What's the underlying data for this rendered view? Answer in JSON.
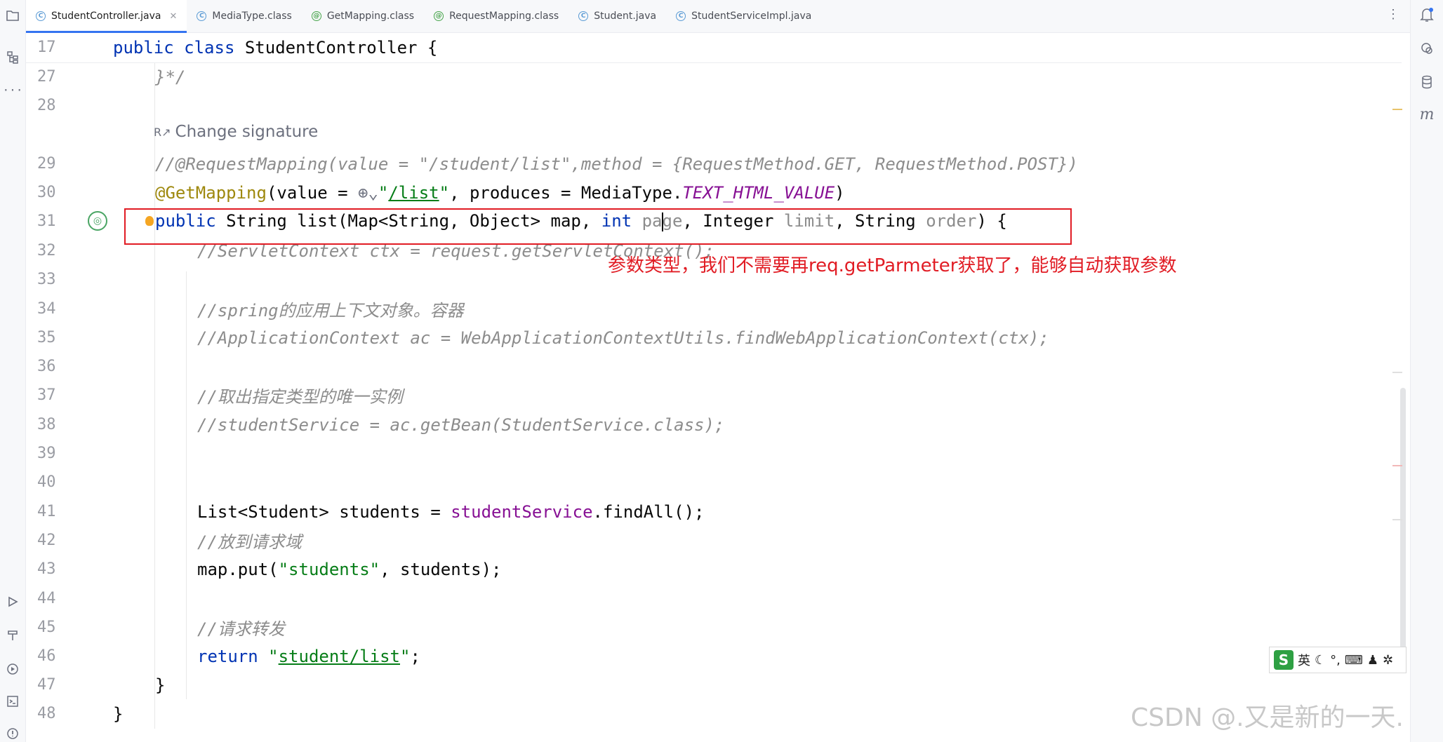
{
  "tabs": [
    {
      "label": "StudentController.java",
      "icon": "class-icon",
      "active": true,
      "closable": true
    },
    {
      "label": "MediaType.class",
      "icon": "class-icon",
      "active": false
    },
    {
      "label": "GetMapping.class",
      "icon": "annotation-icon",
      "active": false
    },
    {
      "label": "RequestMapping.class",
      "icon": "annotation-icon",
      "active": false
    },
    {
      "label": "Student.java",
      "icon": "class-icon",
      "active": false
    },
    {
      "label": "StudentServiceImpl.java",
      "icon": "class-icon",
      "active": false
    }
  ],
  "inspections": {
    "warnings": "4",
    "weak_warnings": "2"
  },
  "sticky": {
    "line": "17",
    "code": "public class StudentController {"
  },
  "inlay_hint": {
    "label": "Change signature"
  },
  "lines": [
    {
      "num": "27",
      "text": "}*/"
    },
    {
      "num": "28",
      "text": ""
    },
    {
      "num": "29",
      "text": "//@RequestMapping(value = \"/student/list\",method = {RequestMethod.GET, RequestMethod.POST})"
    },
    {
      "num": "30",
      "text": "@GetMapping(value = \"/list\", produces = MediaType.TEXT_HTML_VALUE)"
    },
    {
      "num": "31",
      "text": "public String list(Map<String, Object> map, int page, Integer limit, String order) {"
    },
    {
      "num": "32",
      "text": "//ServletContext ctx = request.getServletContext();"
    },
    {
      "num": "33",
      "text": ""
    },
    {
      "num": "34",
      "text": "//spring的应用上下文对象。容器"
    },
    {
      "num": "35",
      "text": "//ApplicationContext ac = WebApplicationContextUtils.findWebApplicationContext(ctx);"
    },
    {
      "num": "36",
      "text": ""
    },
    {
      "num": "37",
      "text": "//取出指定类型的唯一实例"
    },
    {
      "num": "38",
      "text": "//studentService = ac.getBean(StudentService.class);"
    },
    {
      "num": "39",
      "text": ""
    },
    {
      "num": "40",
      "text": ""
    },
    {
      "num": "41",
      "text": "List<Student> students = studentService.findAll();"
    },
    {
      "num": "42",
      "text": "//放到请求域"
    },
    {
      "num": "43",
      "text": "map.put(\"students\", students);"
    },
    {
      "num": "44",
      "text": ""
    },
    {
      "num": "45",
      "text": "//请求转发"
    },
    {
      "num": "46",
      "text": "return \"student/list\";"
    },
    {
      "num": "47",
      "text": "}"
    },
    {
      "num": "48",
      "text": "}"
    }
  ],
  "annotation": "参数类型，我们不需要再req.getParmeter获取了，能够自动获取参数",
  "ime": {
    "logo": "S",
    "mode": "英"
  },
  "watermark": "CSDN @.又是新的一天.",
  "colors": {
    "accent": "#3574f0",
    "annotation_red": "#e11c24",
    "keyword": "#0033b3",
    "string": "#067d17",
    "comment": "#8c8c8c"
  }
}
